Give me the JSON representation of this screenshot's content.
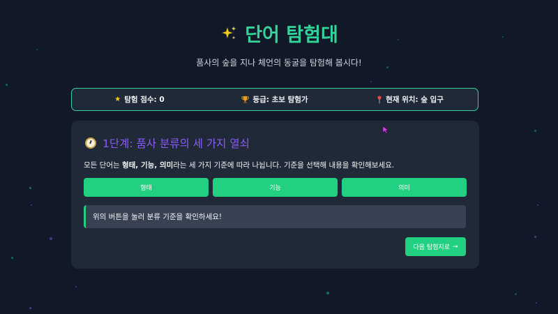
{
  "header": {
    "title": "단어 탐험대",
    "subtitle": "품사의 숲을 지나 체언의 동굴을 탐험해 봅시다!"
  },
  "status": {
    "score_icon": "star-icon",
    "score": "탐험 점수: 0",
    "rank_icon": "trophy-icon",
    "rank": "등급: 초보 탐험가",
    "location_icon": "pin-icon",
    "location": "현재 위치: 숲 입구"
  },
  "stage": {
    "icon": "compass-icon",
    "title": "1단계: 품사 분류의 세 가지 열쇠",
    "desc_prefix": "모든 단어는 ",
    "desc_bold": "형태, 기능, 의미",
    "desc_suffix": "라는 세 가지 기준에 따라 나뉩니다. 기준을 선택해 내용을 확인해보세요.",
    "tabs": [
      {
        "label": "형태"
      },
      {
        "label": "기능"
      },
      {
        "label": "의미"
      }
    ],
    "info": "위의 버튼을 눌러 분류 기준을 확인하세요!",
    "next_label": "다음 탐험지로",
    "next_arrow": "→"
  },
  "colors": {
    "background": "#111827",
    "card": "#1f2937",
    "accent": "#22d081",
    "title": "#34d399",
    "stage_title": "#8b5cf6"
  }
}
